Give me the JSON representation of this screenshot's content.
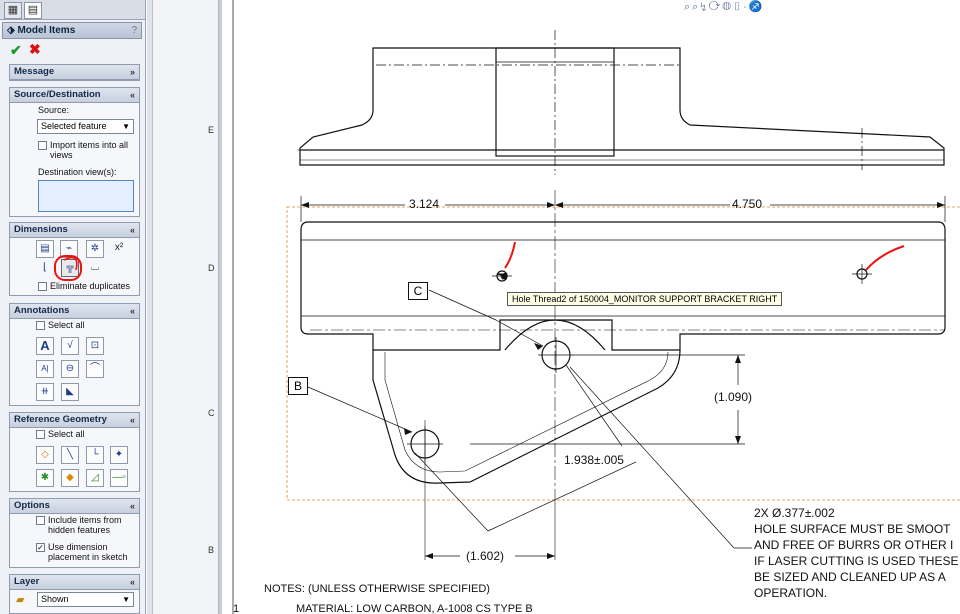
{
  "property_manager": {
    "title": "Model Items",
    "help": "?",
    "message_group": {
      "title": "Message"
    },
    "source_group": {
      "title": "Source/Destination",
      "source_label": "Source:",
      "source_value": "Selected feature",
      "import_all_label_1": "Import items into all",
      "import_all_label_2": "views",
      "destination_label": "Destination view(s):"
    },
    "dimensions_group": {
      "title": "Dimensions",
      "eliminate_duplicates": "Eliminate duplicates"
    },
    "annotations_group": {
      "title": "Annotations",
      "select_all": "Select all"
    },
    "reference_group": {
      "title": "Reference Geometry",
      "select_all": "Select all"
    },
    "options_group": {
      "title": "Options",
      "include_hidden_1": "Include items from",
      "include_hidden_2": "hidden features",
      "use_dim_placement_1": "Use dimension",
      "use_dim_placement_2": "placement in sketch"
    },
    "layer_group": {
      "title": "Layer",
      "layer_value": "Shown"
    }
  },
  "drawing": {
    "zones": [
      "E",
      "D",
      "C",
      "B"
    ],
    "dims": {
      "d1": "3.124",
      "d2": "4.750",
      "d3": "(1.090)",
      "d4": "1.938±.005",
      "d5": "(1.602)"
    },
    "datums": [
      "C",
      "B"
    ],
    "tooltip": "Hole Thread2 of 150004_MONITOR SUPPORT BRACKET RIGHT",
    "note_lines": [
      "2X  Ø.377±.002",
      "HOLE SURFACE MUST BE SMOOT",
      "AND FREE OF BURRS OR OTHER I",
      "IF LASER CUTTING IS USED THESE",
      "BE SIZED AND CLEANED UP AS A",
      "OPERATION."
    ],
    "notes_title": "NOTES: (UNLESS OTHERWISE SPECIFIED)",
    "notes_item_num": "1",
    "notes_item_text": "MATERIAL: LOW CARBON, A-1008 CS TYPE B"
  },
  "colors": {
    "accent_green": "#1f9a2a",
    "cancel_red": "#dd1111",
    "annotation_red": "#ee1111",
    "boundary_orange": "#e08a3a"
  }
}
